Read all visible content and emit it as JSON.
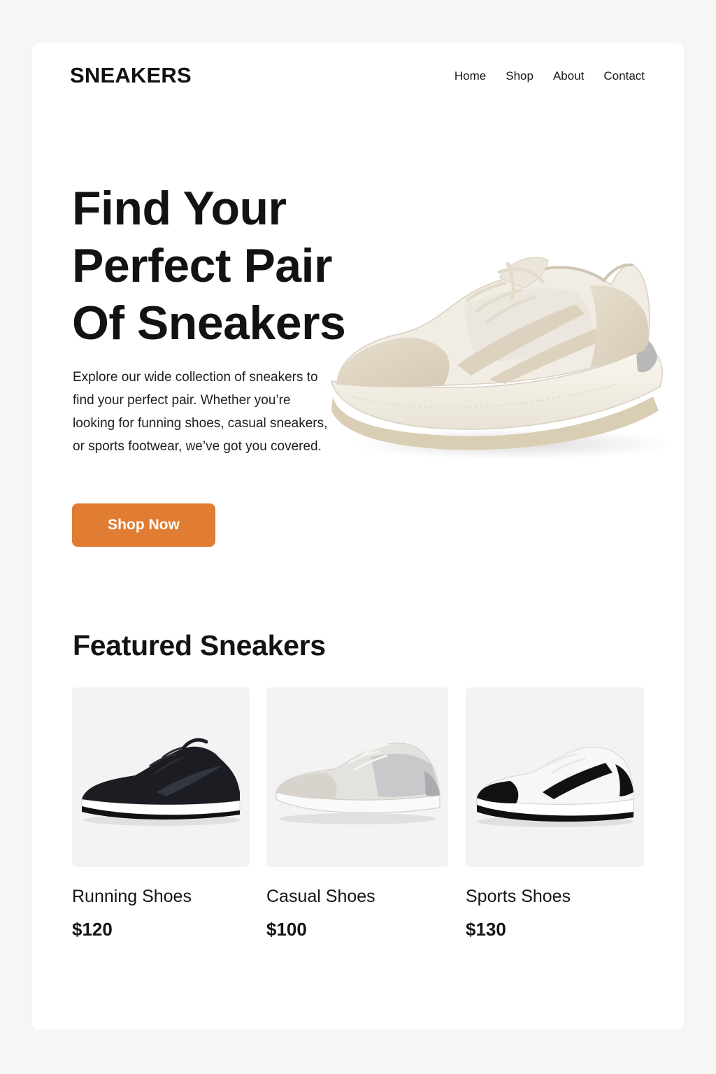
{
  "header": {
    "logo": "SNEAKERS",
    "nav": [
      "Home",
      "Shop",
      "About",
      "Contact"
    ]
  },
  "hero": {
    "title_lines": [
      "Find Your",
      "Perfect Pair",
      "Of Sneakers"
    ],
    "description": "Explore our wide collection of sneakers to find your perfect pair. Whether you’re looking for funning shoes, casual sneakers, or sports footwear, we’ve got you covered.",
    "cta_label": "Shop Now",
    "image": "beige-running-sneaker-image"
  },
  "featured": {
    "title": "Featured Sneakers",
    "products": [
      {
        "name": "Running Shoes",
        "price": "$120",
        "image": "black-running-sneaker-image"
      },
      {
        "name": "Casual Shoes",
        "price": "$100",
        "image": "grey-casual-sneaker-image"
      },
      {
        "name": "Sports Shoes",
        "price": "$130",
        "image": "white-black-sports-sneaker-image"
      }
    ]
  },
  "colors": {
    "accent": "#e07d32",
    "page_background": "#f6f6f6",
    "card_background": "#ffffff",
    "product_tile": "#f3f3f3"
  }
}
